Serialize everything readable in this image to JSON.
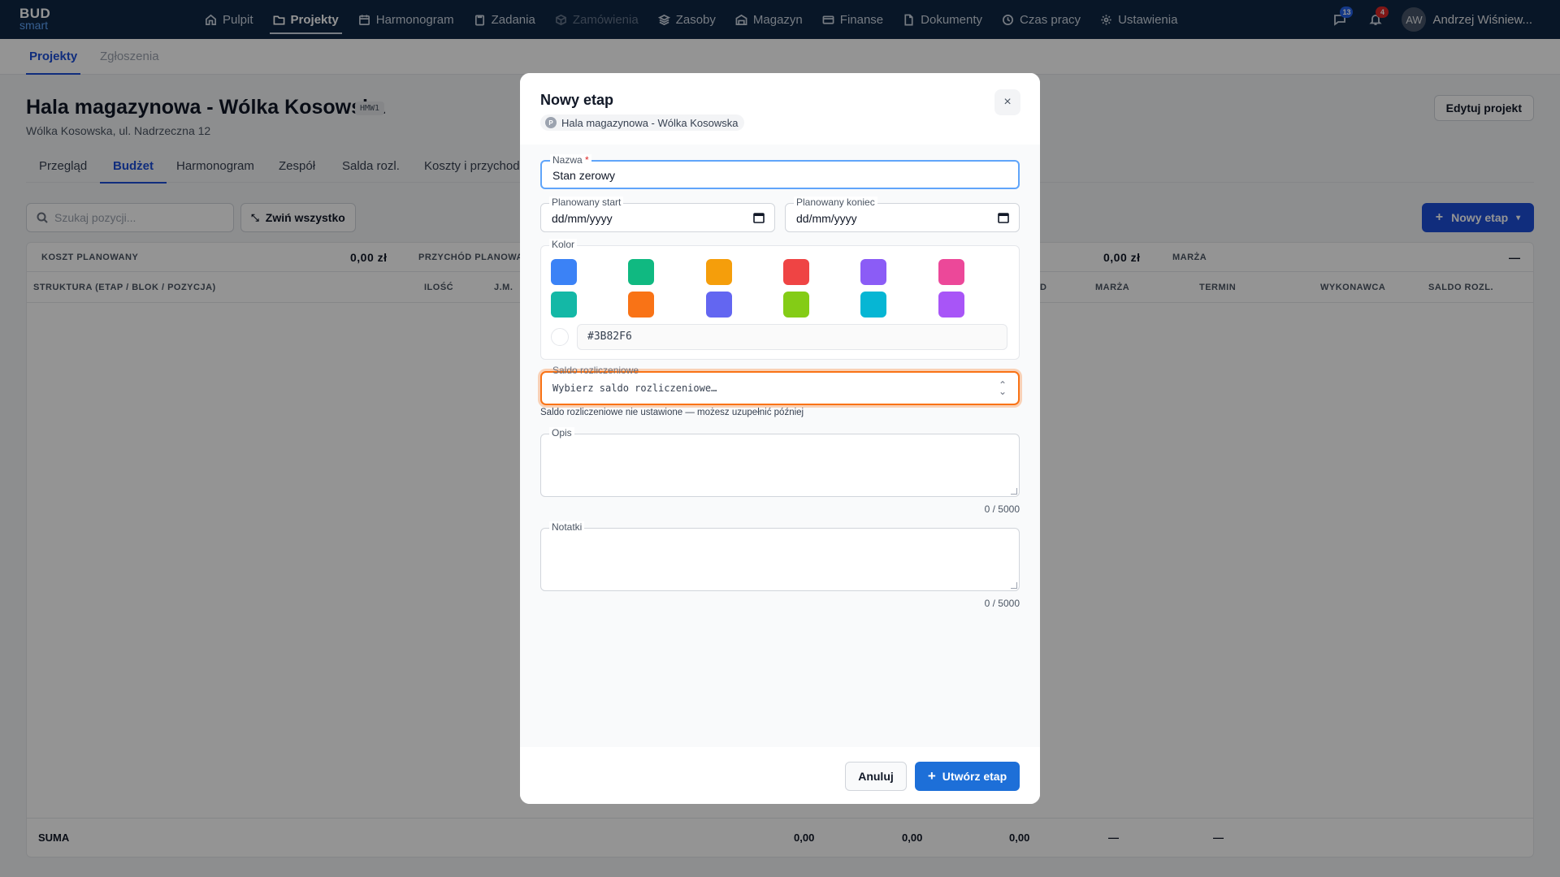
{
  "brand": {
    "line1": "BUD",
    "line2": "smart"
  },
  "nav": {
    "items": [
      {
        "label": "Pulpit",
        "icon": "home-icon"
      },
      {
        "label": "Projekty",
        "icon": "folder-icon"
      },
      {
        "label": "Harmonogram",
        "icon": "calendar-icon"
      },
      {
        "label": "Zadania",
        "icon": "clipboard-icon"
      },
      {
        "label": "Zamówienia",
        "icon": "box-icon"
      },
      {
        "label": "Zasoby",
        "icon": "layers-icon"
      },
      {
        "label": "Magazyn",
        "icon": "warehouse-icon"
      },
      {
        "label": "Finanse",
        "icon": "card-icon"
      },
      {
        "label": "Dokumenty",
        "icon": "document-icon"
      },
      {
        "label": "Czas pracy",
        "icon": "clock-icon"
      },
      {
        "label": "Ustawienia",
        "icon": "gear-icon"
      }
    ],
    "messages_count": "13",
    "notifications_count": "4",
    "user_initials": "AW",
    "user_name": "Andrzej Wiśniew..."
  },
  "subtabs": {
    "projects": "Projekty",
    "reports": "Zgłoszenia"
  },
  "project": {
    "title": "Hala magazynowa - Wólka Kosowska",
    "code": "HMW1",
    "address": "Wólka Kosowska, ul. Nadrzeczna 12",
    "edit_label": "Edytuj projekt",
    "tabs": [
      "Przegląd",
      "Budżet",
      "Harmonogram",
      "Zespół",
      "Salda rozl.",
      "Koszty i przychod"
    ]
  },
  "toolbar": {
    "search_placeholder": "Szukaj pozycji...",
    "collapse_label": "Zwiń wszystko",
    "new_stage_label": "Nowy etap"
  },
  "summary": {
    "planned_cost_label": "KOSZT PLANOWANY",
    "planned_cost_value": "0,00 zł",
    "planned_income_label": "PRZYCHÓD PLANOWA",
    "other_value": "0,00 zł",
    "margin_label": "MARŻA",
    "margin_value": "—"
  },
  "table": {
    "columns": {
      "structure": "STRUKTURA (ETAP / BLOK / POZYCJA)",
      "qty": "ILOŚĆ",
      "unit": "J.M.",
      "d": "D",
      "margin": "MARŻA",
      "term": "TERMIN",
      "contractor": "WYKONAWCA",
      "balance": "SALDO ROZL."
    },
    "footer": {
      "label": "SUMA",
      "v1": "0,00",
      "v2": "0,00",
      "v3": "0,00",
      "v4": "—",
      "v5": "—"
    }
  },
  "modal": {
    "title": "Nowy etap",
    "project_chip": "Hala magazynowa - Wólka Kosowska",
    "chip_letter": "P",
    "close_icon": "×",
    "name_label": "Nazwa",
    "name_required": "*",
    "name_value": "Stan zerowy",
    "start_label": "Planowany start",
    "start_value": "dd/mm/yyyy",
    "end_label": "Planowany koniec",
    "end_value": "dd/mm/yyyy",
    "color_label": "Kolor",
    "colors": [
      "#3B82F6",
      "#10B981",
      "#F59E0B",
      "#EF4444",
      "#8B5CF6",
      "#EC4899",
      "#14B8A6",
      "#F97316",
      "#6366F1",
      "#84CC16",
      "#06B6D4",
      "#A855F7"
    ],
    "color_hex": "#3B82F6",
    "balance_label": "Saldo rozliczeniowe",
    "balance_placeholder": "Wybierz saldo rozliczeniowe…",
    "balance_hint": "Saldo rozliczeniowe nie ustawione — możesz uzupełnić później",
    "desc_label": "Opis",
    "desc_counter": "0 / 5000",
    "notes_label": "Notatki",
    "notes_counter": "0 / 5000",
    "cancel_label": "Anuluj",
    "create_label": "Utwórz etap"
  }
}
